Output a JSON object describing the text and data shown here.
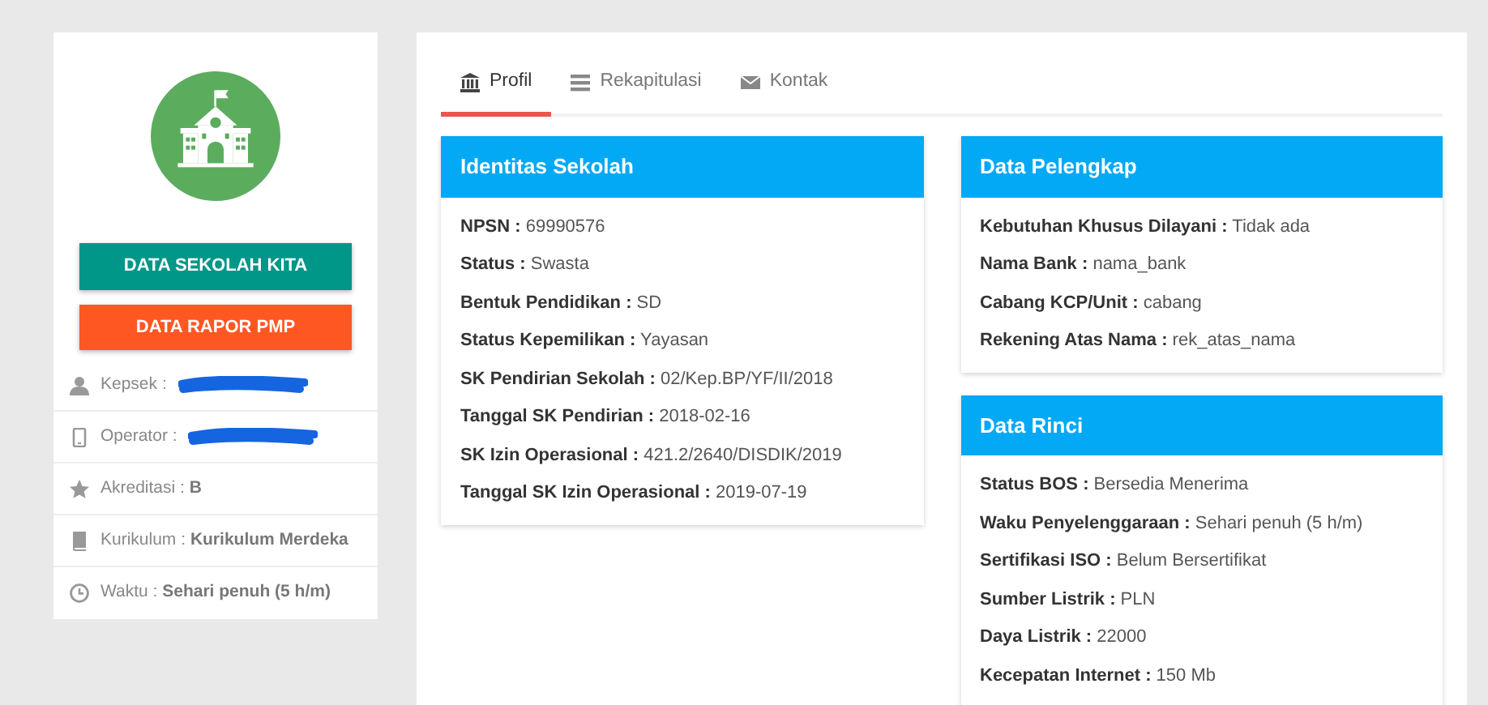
{
  "sidebar": {
    "buttons": [
      {
        "label": "DATA SEKOLAH KITA",
        "kind": "primary"
      },
      {
        "label": "DATA RAPOR PMP",
        "kind": "accent"
      }
    ],
    "items": [
      {
        "label": "Kepsek :",
        "redacted": true
      },
      {
        "label": "Operator :",
        "redacted": true
      },
      {
        "label": "Akreditasi :",
        "value": "B",
        "redacted": false
      },
      {
        "label": "Kurikulum :",
        "value": "Kurikulum Merdeka",
        "redacted": false
      },
      {
        "label": "Waktu :",
        "value": "Sehari penuh (5 h/m)",
        "redacted": false
      }
    ]
  },
  "tabs": [
    {
      "label": "Profil",
      "selected": true
    },
    {
      "label": "Rekapitulasi",
      "selected": false
    },
    {
      "label": "Kontak",
      "selected": false
    }
  ],
  "columns": [
    [
      {
        "title": "Identitas Sekolah",
        "rows": [
          "**NPSN :** 69990576",
          "**Status :** Swasta",
          "**Bentuk Pendidikan :** SD",
          "**Status Kepemilikan :** Yayasan",
          "**SK Pendirian Sekolah :** 02/Kep.BP/YF/II/2018",
          "**Tanggal SK Pendirian :** 2018-02-16",
          "**SK Izin Operasional :** 421.2/2640/DISDIK/2019",
          "**Tanggal SK Izin Operasional :** 2019-07-19"
        ]
      }
    ],
    [
      {
        "title": "Data Pelengkap",
        "rows": [
          "**Kebutuhan Khusus Dilayani :** Tidak ada",
          "**Nama Bank :** nama_bank",
          "**Cabang KCP/Unit :** cabang",
          "**Rekening Atas Nama :** rek_atas_nama"
        ]
      },
      {
        "title": "Data Rinci",
        "rows": [
          "**Status BOS :** Bersedia Menerima",
          "**Waku Penyelenggaraan :** Sehari penuh (5 h/m)",
          "**Sertifikasi ISO :** Belum Bersertifikat",
          "**Sumber Listrik :** PLN",
          "**Daya Listrik :** 22000",
          "**Kecepatan Internet :** 150 Mb"
        ]
      }
    ]
  ]
}
